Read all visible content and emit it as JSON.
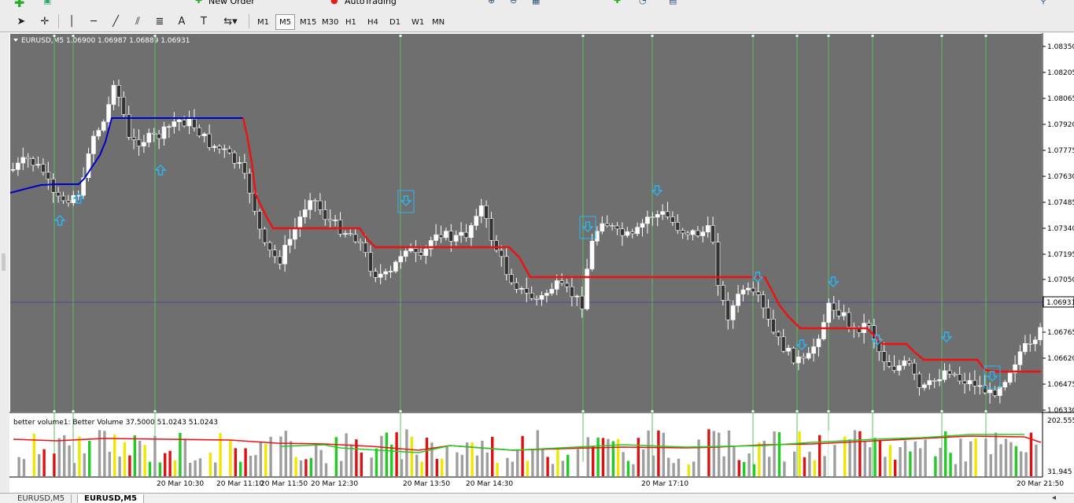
{
  "toolbar": {
    "new_order_label": "New Order",
    "auto_trading_label": "AutoTrading",
    "timeframes": [
      "M1",
      "M5",
      "M15",
      "M30",
      "H1",
      "H4",
      "D1",
      "W1",
      "MN"
    ],
    "active_timeframe": "M5"
  },
  "chart": {
    "header_text": "EURUSD,M5  1.06900 1.06987 1.06889 1.06931",
    "price_ticks": [
      "1.08350",
      "1.08205",
      "1.08065",
      "1.07920",
      "1.07775",
      "1.07630",
      "1.07485",
      "1.07340",
      "1.07195",
      "1.07050",
      "1.06765",
      "1.06620",
      "1.06475",
      "1.06330"
    ],
    "current_price_label": "1.06931",
    "indicator_header": "better volume1:  Better Volume 37.5000 51.0243 51.0243",
    "indicator_top_label": "202.555",
    "indicator_bottom_label": "31.945",
    "time_labels": [
      "20 Mar 10:30",
      "20 Mar 11:10",
      "20 Mar 11:50",
      "20 Mar 12:30",
      "20 Mar 13:50",
      "20 Mar 14:30",
      "20 Mar 17:10",
      "20 Mar 21:50"
    ],
    "colors": {
      "background": "#6f6f6f",
      "bull_body": "#ffffff",
      "bear_body": "#333333",
      "line_blue": "#0000cc",
      "line_red": "#ee1111",
      "signal_arrow": "#29b6f6",
      "vertical_line": "#5fbf5f",
      "volume_grey": "#9e9e9e",
      "volume_white": "#ffffff",
      "volume_red": "#dd1111",
      "volume_green": "#22cc22",
      "volume_yellow": "#f2e600"
    }
  },
  "tabs": [
    "EURUSD,M5",
    "EURUSD,M5"
  ],
  "active_tab_index": 1
}
